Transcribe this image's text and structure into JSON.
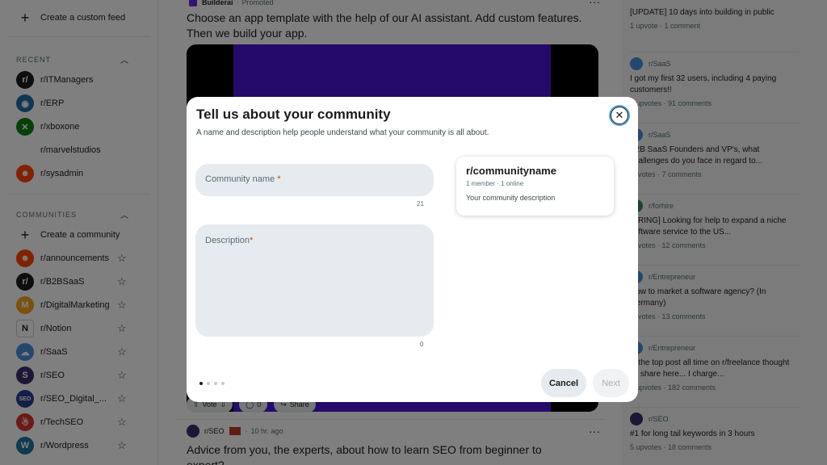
{
  "sidebar": {
    "create_feed": "Create a custom feed",
    "recent_label": "RECENT",
    "recent": [
      {
        "name": "r/ITManagers",
        "color": "#1c1c1c",
        "glyph": "r/"
      },
      {
        "name": "r/ERP",
        "color": "#1d6fa8",
        "glyph": "◉"
      },
      {
        "name": "r/xboxone",
        "color": "#107c10",
        "glyph": "✕"
      },
      {
        "name": "r/marvelstudios",
        "color": "#ffffff",
        "glyph": ""
      },
      {
        "name": "r/sysadmin",
        "color": "#ff4500",
        "glyph": "☻"
      }
    ],
    "communities_label": "COMMUNITIES",
    "create_community": "Create a community",
    "communities": [
      {
        "name": "r/announcements",
        "color": "#ff4500",
        "glyph": "☻"
      },
      {
        "name": "r/B2BSaaS",
        "color": "#1c1c1c",
        "glyph": "r/"
      },
      {
        "name": "r/DigitalMarketing",
        "color": "#f7a21b",
        "glyph": "M"
      },
      {
        "name": "r/Notion",
        "color": "#ffffff",
        "glyph": "N"
      },
      {
        "name": "r/SaaS",
        "color": "#4c8ed9",
        "glyph": "☁"
      },
      {
        "name": "r/SEO",
        "color": "#3a2c6b",
        "glyph": "S"
      },
      {
        "name": "r/SEO_Digital_...",
        "color": "#2b3d8f",
        "glyph": "SEO"
      },
      {
        "name": "r/TechSEO",
        "color": "#d9352b",
        "glyph": "☃"
      },
      {
        "name": "r/Wordpress",
        "color": "#21759b",
        "glyph": "W"
      }
    ]
  },
  "feed": {
    "promo_author": "Builderai",
    "promo_tag": "Promoted",
    "promo_title": "Choose an app template with the help of our AI assistant. Add custom features. Then we build your app.",
    "vote_label": "Vote",
    "comments_count": "0",
    "share_label": "Share",
    "post2_sub": "r/SEO",
    "post2_time": "10 hr. ago",
    "post2_title": "Advice from you, the experts, about how to learn SEO from beginner to expert?"
  },
  "right": [
    {
      "sub": "",
      "title": "[UPDATE] 10 days into building in public",
      "stats": "1 upvote · 1 comment",
      "color": ""
    },
    {
      "sub": "r/SaaS",
      "title": "I got my first 32 users, including 4 paying customers!!",
      "stats": "1 upvotes · 91 comments",
      "color": "#4c8ed9"
    },
    {
      "sub": "r/SaaS",
      "title": "B2B SaaS Founders and VP's, what challenges do you face in regard to...",
      "stats": "upvotes · 7 comments",
      "color": "#4c8ed9"
    },
    {
      "sub": "r/forhire",
      "title": "HIRING] Looking for help to expand a niche software service to the US...",
      "stats": "upvotes · 12 comments",
      "color": "#2e8b57"
    },
    {
      "sub": "r/Entrepreneur",
      "title": "How to market a software agency? (In Germany)",
      "stats": "upvotes · 13 comments",
      "color": "#4c8ed9"
    },
    {
      "sub": "r/Entrepreneur",
      "title": "st the top post all time on r/freelance thought I'd share here... I charge...",
      "stats": "5 upvotes · 182 comments",
      "color": "#4c8ed9"
    },
    {
      "sub": "r/SEO",
      "title": "#1 for long tail keywords in 3 hours",
      "stats": "5 upvotes · 18 comments",
      "color": "#3a2c6b"
    }
  ],
  "modal": {
    "title": "Tell us about your community",
    "subtitle": "A name and description help people understand what your community is all about.",
    "name_placeholder": "Community name",
    "name_required": "*",
    "name_counter": "21",
    "desc_placeholder": "Description",
    "desc_required": "*",
    "desc_counter": "0",
    "preview_name": "r/communityname",
    "preview_members": "1 member",
    "preview_online": "1 online",
    "preview_desc": "Your community description",
    "cancel_label": "Cancel",
    "next_label": "Next",
    "step_current": 1,
    "step_total": 4
  }
}
